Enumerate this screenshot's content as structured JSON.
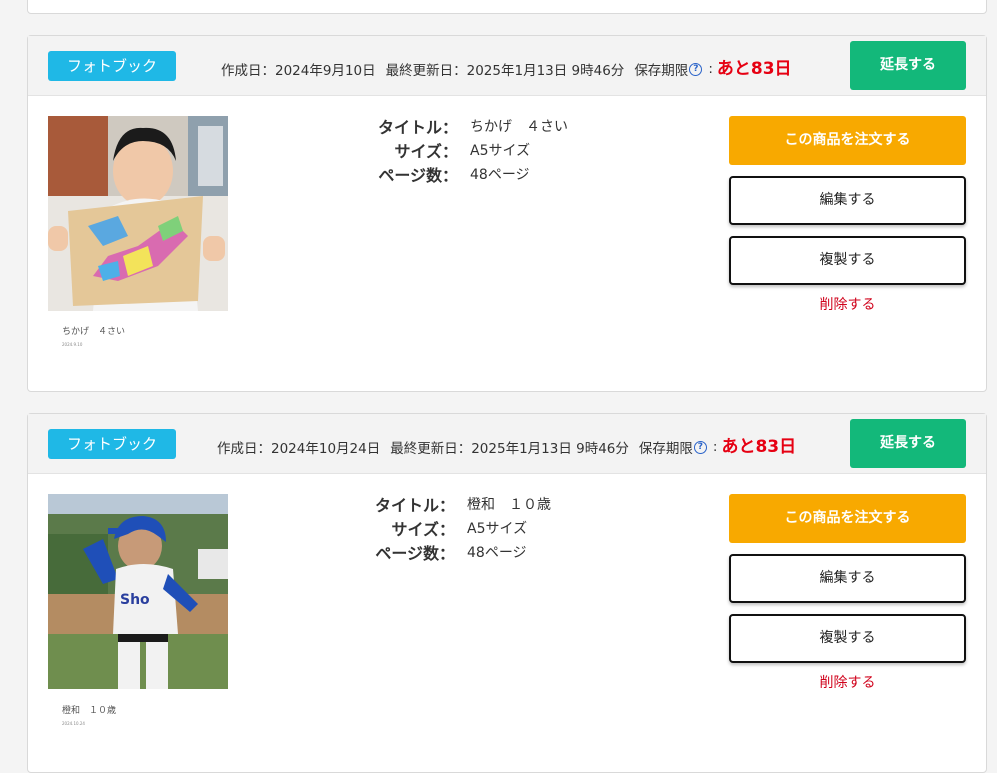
{
  "projects": [
    {
      "type_label": "フォトブック",
      "created_label": "作成日：",
      "created_date": "2024年9月10日",
      "updated_label": "最終更新日：",
      "updated_date": "2025年1月13日 9時46分",
      "retention_label": "保存期限",
      "remaining": "あと83日",
      "extend_label": "延長する",
      "thumb_caption": "ちかげ　４さい",
      "thumb_date": "2024.9.10",
      "title_label": "タイトル：",
      "title_value": "ちかげ　４さい",
      "size_label": "サイズ：",
      "size_value": "A5サイズ",
      "pages_label": "ページ数：",
      "pages_value": "48ページ",
      "order_label": "この商品を注文する",
      "edit_label": "編集する",
      "copy_label": "複製する",
      "delete_label": "削除する"
    },
    {
      "type_label": "フォトブック",
      "created_label": "作成日：",
      "created_date": "2024年10月24日",
      "updated_label": "最終更新日：",
      "updated_date": "2025年1月13日 9時46分",
      "retention_label": "保存期限",
      "remaining": "あと83日",
      "extend_label": "延長する",
      "thumb_caption": "橙和　１０歳",
      "thumb_date": "2024.10.24",
      "title_label": "タイトル：",
      "title_value": "橙和　１０歳",
      "size_label": "サイズ：",
      "size_value": "A5サイズ",
      "pages_label": "ページ数：",
      "pages_value": "48ページ",
      "order_label": "この商品を注文する",
      "edit_label": "編集する",
      "copy_label": "複製する",
      "delete_label": "削除する"
    }
  ],
  "help_icon_glyph": "?",
  "colors": {
    "badge": "#1fb8e6",
    "extend": "#13b87a",
    "order": "#f8a900",
    "remaining": "#e60012",
    "delete": "#d0021b"
  }
}
